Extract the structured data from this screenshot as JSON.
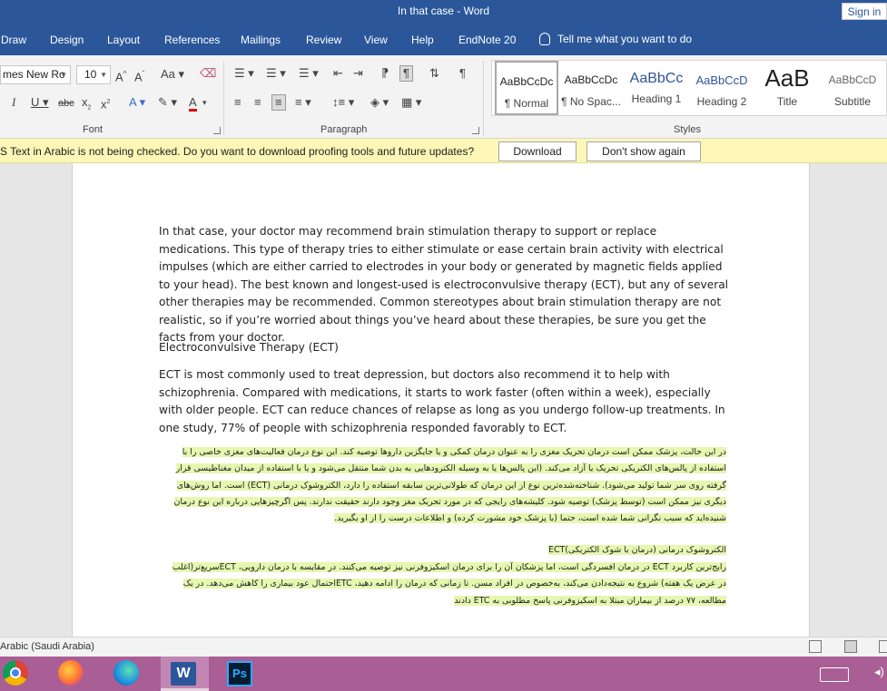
{
  "window": {
    "title": "In that case  -  Word",
    "sign_in": "Sign in"
  },
  "tabs": [
    "Draw",
    "Design",
    "Layout",
    "References",
    "Mailings",
    "Review",
    "View",
    "Help",
    "EndNote 20"
  ],
  "tell_me": "Tell me what you want to do",
  "ribbon": {
    "font_name": "mes New Ro",
    "font_size": "10",
    "font_group_label": "Font",
    "paragraph_group_label": "Paragraph",
    "styles_group_label": "Styles",
    "styles": [
      {
        "preview": "AaBbCcDc",
        "name": "¶ Normal"
      },
      {
        "preview": "AaBbCcDc",
        "name": "¶ No Spac..."
      },
      {
        "preview": "AaBbCc",
        "name": "Heading 1"
      },
      {
        "preview": "AaBbCcD",
        "name": "Heading 2"
      },
      {
        "preview": "AaB",
        "name": "Title"
      },
      {
        "preview": "AaBbCcD",
        "name": "Subtitle"
      }
    ]
  },
  "message_bar": {
    "text": "S   Text in Arabic is not being checked. Do you want to download proofing tools and future updates?",
    "download": "Download",
    "dont_show": "Don't show again"
  },
  "document": {
    "p1": "In that case, your doctor may recommend brain stimulation therapy to support or replace medications. This type of therapy tries to either stimulate or ease certain brain activity with electrical impulses (which are either carried to electrodes in your body or generated by magnetic fields applied to your head). The best known and longest-used is electroconvulsive therapy (ECT), but any of several other therapies may be recommended. Common stereotypes about brain stimulation therapy are not realistic, so if you’re worried about things you’ve heard about these therapies, be sure you get the facts from your doctor.",
    "heading": "Electroconvulsive Therapy (ECT)",
    "p2": "ECT is most commonly used to treat depression, but doctors also recommend it to help with schizophrenia. Compared with medications, it starts to work faster (often within a week), especially with older people. ECT can reduce chances of relapse as long as you undergo follow-up treatments. In one study, 77% of people with schizophrenia responded favorably to ECT.",
    "ar1": "در این حالت، پزشک ممکن است درمان تحریک مغزی را به عنوان درمان کمکی و یا جایگزین داروها توصیه کند. این نوع درمان فعالیت‌های مغزی خاصی را با استفاده از پالس‌های الکتریکی تحریک یا آزاد می‌کند. (این پالس‌ها یا به وسیله الکترودهایی به بدن شما منتقل می‌شود و یا با استفاده از میدان مغناطیسی قرار گرفته روی سر شما تولید می‌شود). شناخته‌شده‌ترین نوع از این درمان که طولانی‌ترین سابقه استفاده را دارد، الکتروشوک درمانی (ECT) است. اما روش‌های دیگری نیز ممکن است (توسط پزشک) توصیه شود. کلیشه‌های رایجی که در مورد تحریک مغز وجود دارند حقیقت ندارند. پس اگرچیزهایی درباره این نوع درمان شنیده‌اید که سبب نگرانی شما شده است، حتما (با پزشک خود مشورت کرده) و اطلاعات درست را از او بگیرید.",
    "ar2": "الکتروشوک درمانی (درمان با شوک الکتریکی)ECT",
    "ar3": "رایج‌ترین کاربرد ECT در درمان افسردگی است، اما پزشکان آن را برای درمان اسکیزوفرنی نیز توصیه می‌کنند. در مقایسه با درمان دارویی، ECTسریع‌تر(اغلب در عرض یک هفته) شروع به نتیجه‌دادن می‌کند، به‌خصوص در افراد مسن. تا زمانی که درمان را ادامه دهید، ETCاحتمال عود بیماری را کاهش می‌دهد. در یک مطالعه، ۷۷ درصد از بیماران مبتلا به اسکیزوفرنی پاسخ مطلوبی به ETC دادند"
  },
  "status": {
    "language": "Arabic (Saudi Arabia)"
  },
  "taskbar": {
    "word_letter": "W",
    "ps_letters": "Ps"
  }
}
